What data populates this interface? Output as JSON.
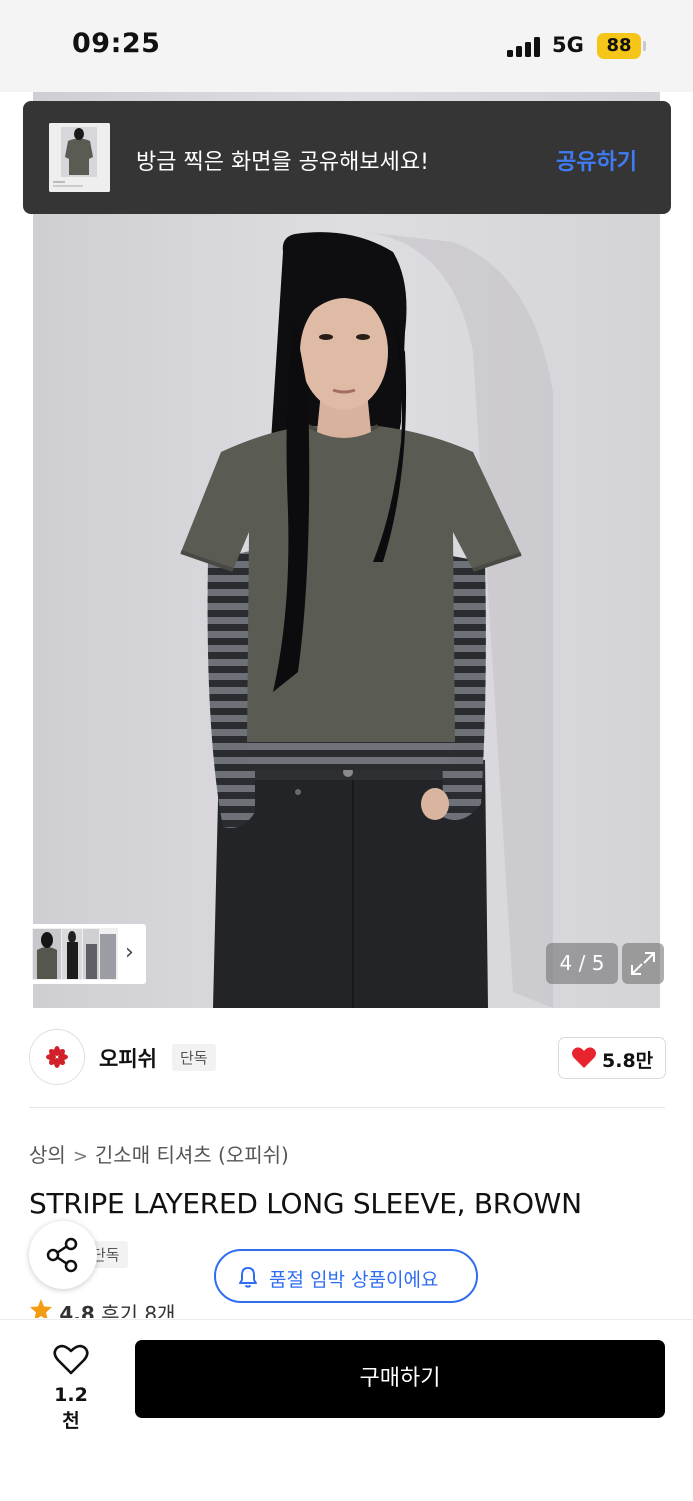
{
  "status_bar": {
    "time": "09:25",
    "network": "5G",
    "battery": "88"
  },
  "toast": {
    "message": "방금 찍은 화면을 공유해보세요!",
    "action_label": "공유하기"
  },
  "gallery": {
    "current": 4,
    "total": 5,
    "indicator": "4 / 5"
  },
  "brand": {
    "name": "오피쉬",
    "badge": "단독",
    "like_count": "5.8만"
  },
  "breadcrumb": {
    "category": "상의",
    "subcategory": "긴소매 티셔츠 (오피쉬)"
  },
  "product": {
    "title": "STRIPE LAYERED LONG SLEEVE, BROWN",
    "badge_partial": "단독",
    "rating": "4.8",
    "reviews": "후기 8개"
  },
  "restock": {
    "label": "품절 임박 상품이에요"
  },
  "bottom_bar": {
    "wish_count": "1.2천",
    "buy_label": "구매하기"
  },
  "colors": {
    "accent_blue": "#2f6ef0",
    "heart_red": "#e8232d",
    "star_orange": "#f39c12",
    "toast_bg": "#353535"
  }
}
